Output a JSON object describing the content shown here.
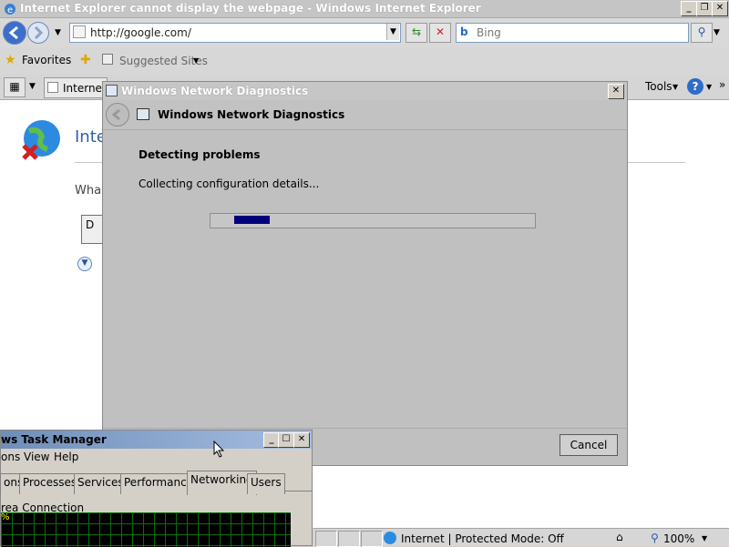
{
  "ie": {
    "title": "Internet Explorer cannot display the webpage - Windows Internet Explorer",
    "address": "http://google.com/",
    "search_placeholder": "Bing",
    "favorites_label": "Favorites",
    "suggested_sites_label": "Suggested Sites",
    "tab_label": "Internet",
    "tools_label": "Tools",
    "page_title_partial": "Inte",
    "page_question_partial": "Wha",
    "page_button_partial": "D"
  },
  "dialog": {
    "title": "Windows Network Diagnostics",
    "header": "Windows Network Diagnostics",
    "heading": "Detecting problems",
    "message": "Collecting configuration details...",
    "progress_pct": 11,
    "cancel_label": "Cancel"
  },
  "task_manager": {
    "title": "ws Task Manager",
    "menu": [
      "ons",
      "View",
      "Help"
    ],
    "tabs": [
      "ons",
      "Processes",
      "Services",
      "Performance",
      "Networking",
      "Users"
    ],
    "selected_tab": "Networking",
    "group_label": "rea Connection",
    "graph_label": "%"
  },
  "statusbar": {
    "zone_text": "Internet | Protected Mode: Off",
    "zoom": "100%"
  },
  "colors": {
    "progress_fill": "#00007c",
    "page_title": "#2f5fa8"
  }
}
